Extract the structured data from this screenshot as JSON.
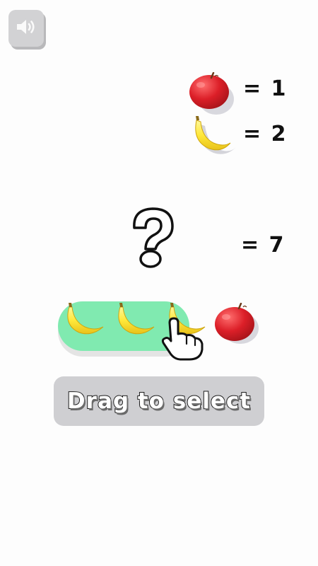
{
  "sound": {
    "icon": "speaker-icon"
  },
  "clues": [
    {
      "icon": "apple-icon",
      "equation": "= 1"
    },
    {
      "icon": "banana-icon",
      "equation": "= 2"
    }
  ],
  "question": {
    "icon": "question-mark-icon",
    "equation": "= 7"
  },
  "fruit_row": {
    "items": [
      "banana-icon",
      "banana-icon",
      "banana-icon",
      "apple-icon"
    ],
    "selected_count": 3
  },
  "hint": {
    "icon": "pointing-hand-icon",
    "label": "Drag to select"
  },
  "colors": {
    "apple": "#d9252c",
    "banana": "#ffe93a",
    "selection": "#80eab0",
    "banner": "#cfcfd2"
  }
}
